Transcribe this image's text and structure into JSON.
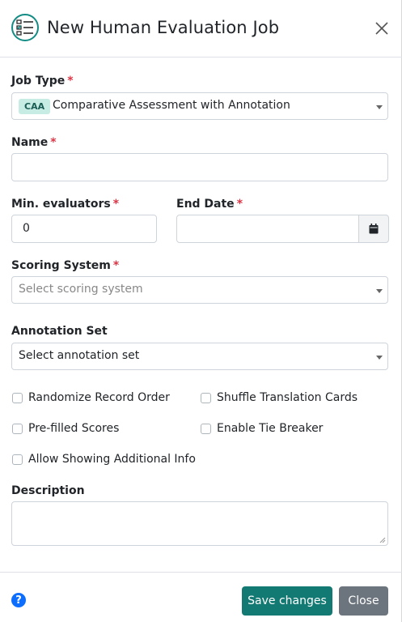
{
  "dialog": {
    "title": "New Human Evaluation Job",
    "icon": "checklist-icon"
  },
  "colors": {
    "accent": "#137a73",
    "required": "#dc3545",
    "badge_bg": "#c6ece4",
    "help": "#0d6efd",
    "secondary": "#6c757d"
  },
  "form": {
    "job_type": {
      "label": "Job Type",
      "required_mark": "*",
      "badge": "CAA",
      "value": "Comparative Assessment with Annotation"
    },
    "name": {
      "label": "Name",
      "required_mark": "*",
      "value": ""
    },
    "min_evaluators": {
      "label": "Min. evaluators",
      "required_mark": "*",
      "value": "0"
    },
    "end_date": {
      "label": "End Date",
      "required_mark": "*",
      "value": "",
      "icon": "calendar-icon"
    },
    "scoring_system": {
      "label": "Scoring System",
      "required_mark": "*",
      "placeholder": "Select scoring system"
    },
    "annotation_set": {
      "label": "Annotation Set",
      "value": "Select annotation set"
    },
    "options": {
      "randomize": "Randomize Record Order",
      "shuffle": "Shuffle Translation Cards",
      "prefilled": "Pre-filled Scores",
      "tie_breaker": "Enable Tie Breaker",
      "additional_info": "Allow Showing Additional Info"
    },
    "description": {
      "label": "Description",
      "value": ""
    }
  },
  "footer": {
    "save_label": "Save changes",
    "close_label": "Close",
    "help_glyph": "?"
  }
}
